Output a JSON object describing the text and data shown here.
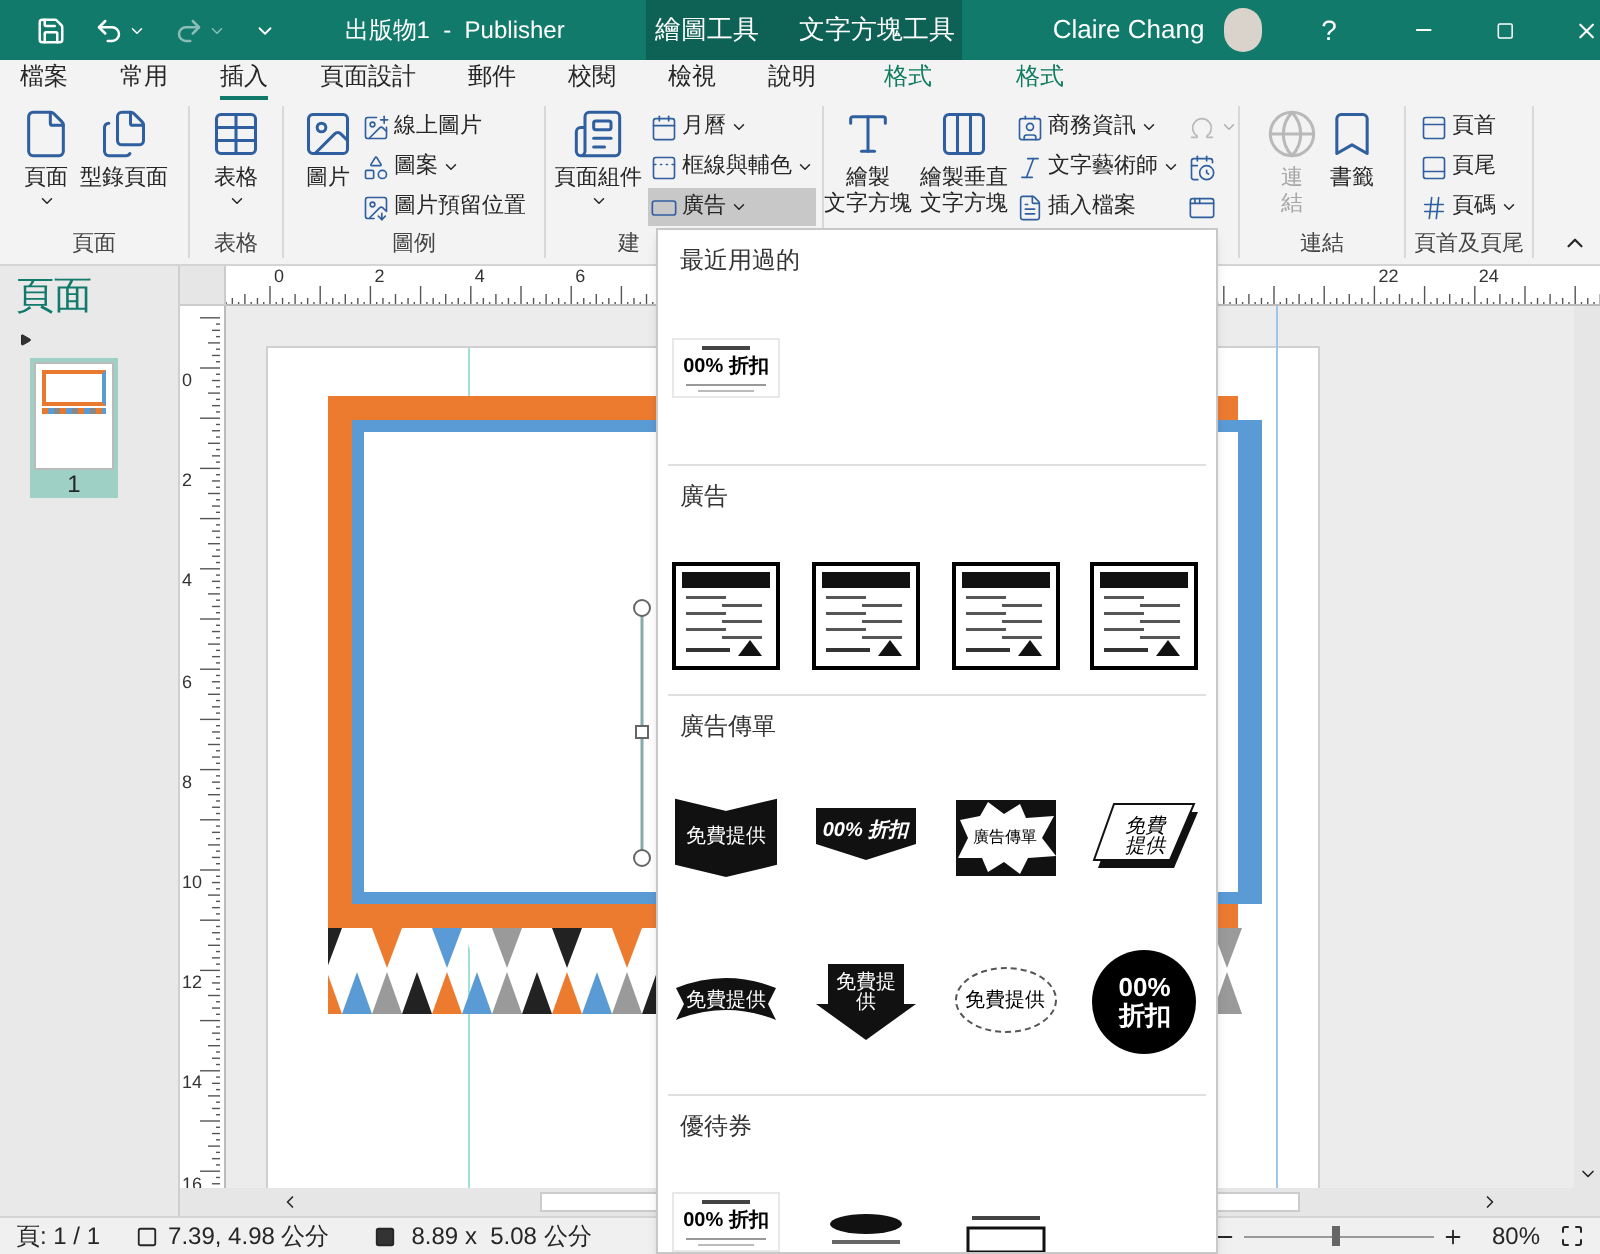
{
  "title_bar": {
    "title": "出版物1  -  Publisher",
    "context_tabs": [
      "繪圖工具",
      "文字方塊工具"
    ],
    "user": "Claire Chang",
    "help": "?"
  },
  "tabs": [
    {
      "label": "檔案",
      "selected": false,
      "kind": "normal"
    },
    {
      "label": "常用",
      "selected": false,
      "kind": "normal"
    },
    {
      "label": "插入",
      "selected": true,
      "kind": "normal"
    },
    {
      "label": "頁面設計",
      "selected": false,
      "kind": "normal"
    },
    {
      "label": "郵件",
      "selected": false,
      "kind": "normal"
    },
    {
      "label": "校閱",
      "selected": false,
      "kind": "normal"
    },
    {
      "label": "檢視",
      "selected": false,
      "kind": "normal"
    },
    {
      "label": "說明",
      "selected": false,
      "kind": "normal"
    },
    {
      "label": "格式",
      "selected": false,
      "kind": "context"
    },
    {
      "label": "格式",
      "selected": false,
      "kind": "context"
    }
  ],
  "ribbon": {
    "groups": [
      {
        "label": "頁面",
        "items": [
          {
            "kind": "large",
            "lines": [
              "頁面"
            ],
            "dropdown": true
          },
          {
            "kind": "large",
            "lines": [
              "型錄頁面"
            ],
            "dropdown": false
          }
        ]
      },
      {
        "label": "表格",
        "items": [
          {
            "kind": "large",
            "lines": [
              "表格"
            ],
            "dropdown": true
          }
        ]
      },
      {
        "label": "圖例",
        "items": [
          {
            "kind": "large",
            "lines": [
              "圖片"
            ],
            "dropdown": false
          },
          {
            "kind": "stack",
            "items": [
              {
                "label": "線上圖片",
                "dropdown": false,
                "disabled": false
              },
              {
                "label": "圖案",
                "dropdown": true,
                "disabled": false
              },
              {
                "label": "圖片預留位置",
                "dropdown": false,
                "disabled": false
              }
            ]
          }
        ]
      },
      {
        "label": "建",
        "items": [
          {
            "kind": "large",
            "lines": [
              "頁面組件"
            ],
            "dropdown": true
          },
          {
            "kind": "stack",
            "items": [
              {
                "label": "月曆",
                "dropdown": true,
                "disabled": false,
                "selected": false
              },
              {
                "label": "框線與輔色",
                "dropdown": true,
                "disabled": false,
                "selected": false
              },
              {
                "label": "廣告",
                "dropdown": true,
                "disabled": false,
                "selected": true
              }
            ]
          }
        ]
      },
      {
        "items": [
          {
            "kind": "large",
            "lines": [
              "繪製",
              "文字方塊"
            ],
            "dropdown": false
          },
          {
            "kind": "large",
            "lines": [
              "繪製垂直",
              "文字方塊"
            ],
            "dropdown": false
          },
          {
            "kind": "stack",
            "items": [
              {
                "label": "商務資訊",
                "dropdown": true,
                "disabled": false
              },
              {
                "label": "文字藝術師",
                "dropdown": true,
                "disabled": false
              },
              {
                "label": "插入檔案",
                "dropdown": false,
                "disabled": false
              }
            ]
          },
          {
            "kind": "stack",
            "items": [
              {
                "dropdown": true,
                "disabled": true
              },
              {
                "dropdown": false,
                "disabled": false
              },
              {
                "dropdown": false,
                "disabled": false
              }
            ]
          }
        ]
      },
      {
        "label": "連結",
        "items": [
          {
            "kind": "large",
            "lines": [
              "連",
              "結"
            ],
            "dropdown": false,
            "disabled": true
          },
          {
            "kind": "large",
            "lines": [
              "書籤"
            ],
            "dropdown": false,
            "disabled": false
          }
        ]
      },
      {
        "label": "頁首及頁尾",
        "items": [
          {
            "kind": "stack",
            "items": [
              {
                "label": "頁首",
                "dropdown": false,
                "disabled": false
              },
              {
                "label": "頁尾",
                "dropdown": false,
                "disabled": false
              },
              {
                "label": "頁碼",
                "dropdown": true,
                "disabled": false
              }
            ]
          }
        ]
      }
    ]
  },
  "pages_pane": {
    "title": "頁面",
    "pages": [
      {
        "number": "1",
        "selected": true
      }
    ]
  },
  "rulers": {
    "horizontal": [
      "0",
      "2",
      "4",
      "6",
      "22",
      "24"
    ],
    "vertical": [
      "0",
      "2",
      "4",
      "6",
      "8",
      "10",
      "12",
      "14",
      "16"
    ]
  },
  "gallery": {
    "sections": [
      {
        "title": "最近用過的",
        "items": [
          {
            "kind": "coupon",
            "text": "00% 折扣"
          }
        ]
      },
      {
        "title": "廣告",
        "items": [
          {
            "kind": "ad"
          },
          {
            "kind": "ad"
          },
          {
            "kind": "ad"
          },
          {
            "kind": "ad"
          }
        ]
      },
      {
        "title": "廣告傳單",
        "items": [
          {
            "kind": "chevron",
            "text": "免費提供"
          },
          {
            "kind": "arrow",
            "text": "00% 折扣"
          },
          {
            "kind": "burst",
            "text": "廣告傳單"
          },
          {
            "kind": "slant",
            "text": "免費提供"
          },
          {
            "kind": "ribbon",
            "text": "免費提供"
          },
          {
            "kind": "down-arrow",
            "text": "免費提供"
          },
          {
            "kind": "scallop",
            "text": "免費提供"
          },
          {
            "kind": "circle",
            "text": "00% 折扣"
          }
        ]
      },
      {
        "title": "優待券",
        "items": [
          {
            "kind": "coupon",
            "text": "00% 折扣"
          },
          {
            "kind": "coupon-oval"
          },
          {
            "kind": "coupon-box"
          }
        ]
      }
    ]
  },
  "status_bar": {
    "page": "頁: 1 / 1",
    "position": "7.39, 4.98 公分",
    "size": "8.89 x  5.08 公分",
    "zoom": "80%",
    "zoom_level": {
      "level": 0.48
    }
  }
}
